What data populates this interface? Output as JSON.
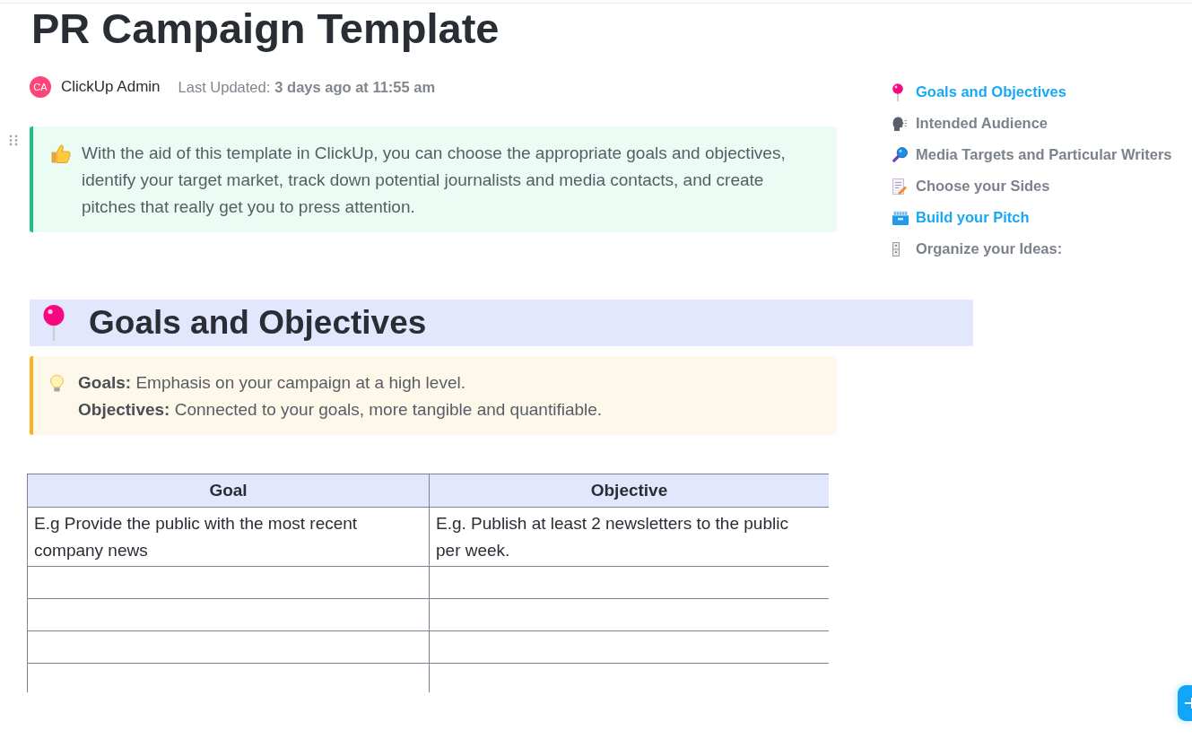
{
  "title": "PR Campaign Template",
  "author": {
    "initials": "CA",
    "name": "ClickUp Admin"
  },
  "last_updated": {
    "label": "Last Updated:",
    "value": "3 days ago at 11:55 am"
  },
  "intro_callout": {
    "text": "With the aid of this template in ClickUp, you can choose the appropriate goals and objectives, identify your target market, track down potential journalists and media contacts, and create pitches that really get you to press attention."
  },
  "table_of_contents": [
    {
      "label": "Goals and Objectives",
      "active": true
    },
    {
      "label": "Intended Audience",
      "active": false
    },
    {
      "label": "Media Targets and Particular Writers",
      "active": false
    },
    {
      "label": "Choose your Sides",
      "active": false
    },
    {
      "label": "Build your Pitch",
      "active": true
    },
    {
      "label": "Organize your Ideas:",
      "active": false
    }
  ],
  "section": {
    "heading": "Goals and Objectives",
    "tip_callout": {
      "lines": [
        "**Goals:** Emphasis on your campaign at a high level.",
        "**Objectives:** Connected to your goals, more tangible and quantifiable."
      ]
    },
    "table": {
      "columns": [
        "Goal",
        "Objective"
      ],
      "rows": [
        {
          "cells": [
            "E.g Provide the public with the most recent company news",
            "E.g. Publish at least 2 newsletters to the public per week."
          ]
        },
        {},
        {},
        {},
        {}
      ]
    }
  }
}
